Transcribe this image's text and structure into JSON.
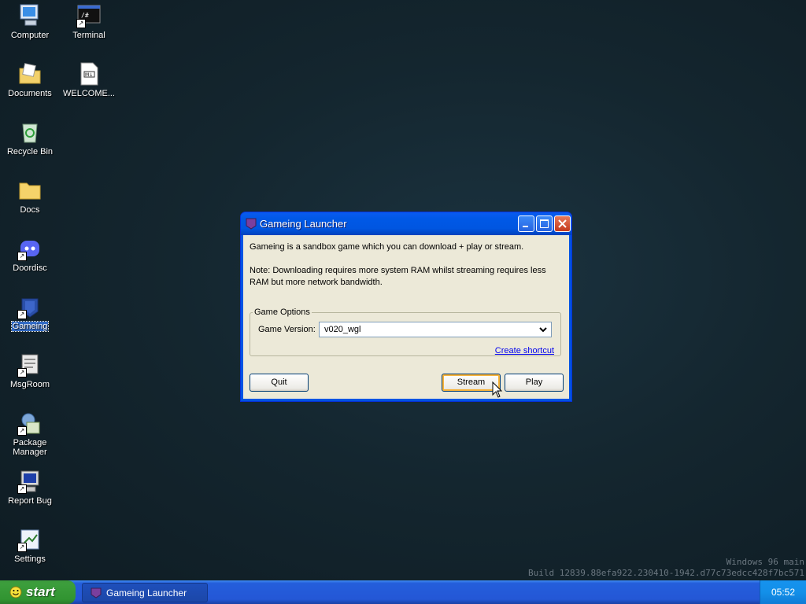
{
  "desktop": {
    "icons": [
      {
        "label": "Computer",
        "icon": "computer-icon",
        "shortcut": false
      },
      {
        "label": "Terminal",
        "icon": "terminal-icon",
        "shortcut": true
      },
      {
        "label": "Documents",
        "icon": "documents-icon",
        "shortcut": false
      },
      {
        "label": "WELCOME...",
        "icon": "markdown-file-icon",
        "shortcut": false
      },
      {
        "label": "Recycle Bin",
        "icon": "recycle-bin-icon",
        "shortcut": false
      },
      {
        "label": "Docs",
        "icon": "folder-icon",
        "shortcut": false
      },
      {
        "label": "Doordisc",
        "icon": "doordisc-icon",
        "shortcut": true
      },
      {
        "label": "Gameing",
        "icon": "gameing-icon",
        "shortcut": true,
        "selected": true
      },
      {
        "label": "MsgRoom",
        "icon": "msgroom-icon",
        "shortcut": true
      },
      {
        "label": "Package Manager",
        "icon": "package-manager-icon",
        "shortcut": true
      },
      {
        "label": "Report Bug",
        "icon": "report-bug-icon",
        "shortcut": true
      },
      {
        "label": "Settings",
        "icon": "settings-icon",
        "shortcut": true
      }
    ]
  },
  "window": {
    "title": "Gameing Launcher",
    "description": "Gameing is a sandbox game which you can download + play or stream.",
    "note": "Note: Downloading requires more system RAM whilst streaming requires less RAM but more network bandwidth.",
    "group_title": "Game Options",
    "version_label": "Game Version:",
    "version_value": "v020_wgl",
    "shortcut_link": "Create shortcut",
    "quit_label": "Quit",
    "stream_label": "Stream",
    "play_label": "Play"
  },
  "watermark": {
    "line1": "Windows 96 main",
    "line2": "Build 12839.88efa922.230410-1942.d77c73edcc428f7bc571"
  },
  "taskbar": {
    "start_label": "start",
    "task_label": "Gameing Launcher",
    "clock": "05:52"
  },
  "colors": {
    "titlebar": "#0058e6",
    "taskbar": "#245edb",
    "start": "#319431",
    "client": "#ece9d8"
  }
}
